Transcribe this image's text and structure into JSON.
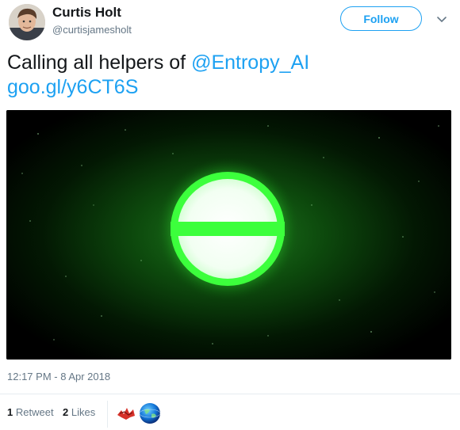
{
  "author": {
    "display_name": "Curtis Holt",
    "handle": "@curtisjamesholt"
  },
  "follow_button": {
    "label": "Follow"
  },
  "tweet": {
    "text_prefix": "Calling all helpers of ",
    "mention": "@Entropy_AI",
    "link": "goo.gl/y6CT6S",
    "timestamp": "12:17 PM - 8 Apr 2018"
  },
  "stats": {
    "retweets_count": "1",
    "retweets_label": "Retweet",
    "likes_count": "2",
    "likes_label": "Likes"
  },
  "colors": {
    "accent": "#1da1f2",
    "logo_green": "#3cff3c",
    "muted": "#657786"
  },
  "icons": [
    "avatar-photo",
    "chevron-down-icon",
    "entropy-logo",
    "liker-avatar-graffiti",
    "liker-avatar-globe"
  ]
}
